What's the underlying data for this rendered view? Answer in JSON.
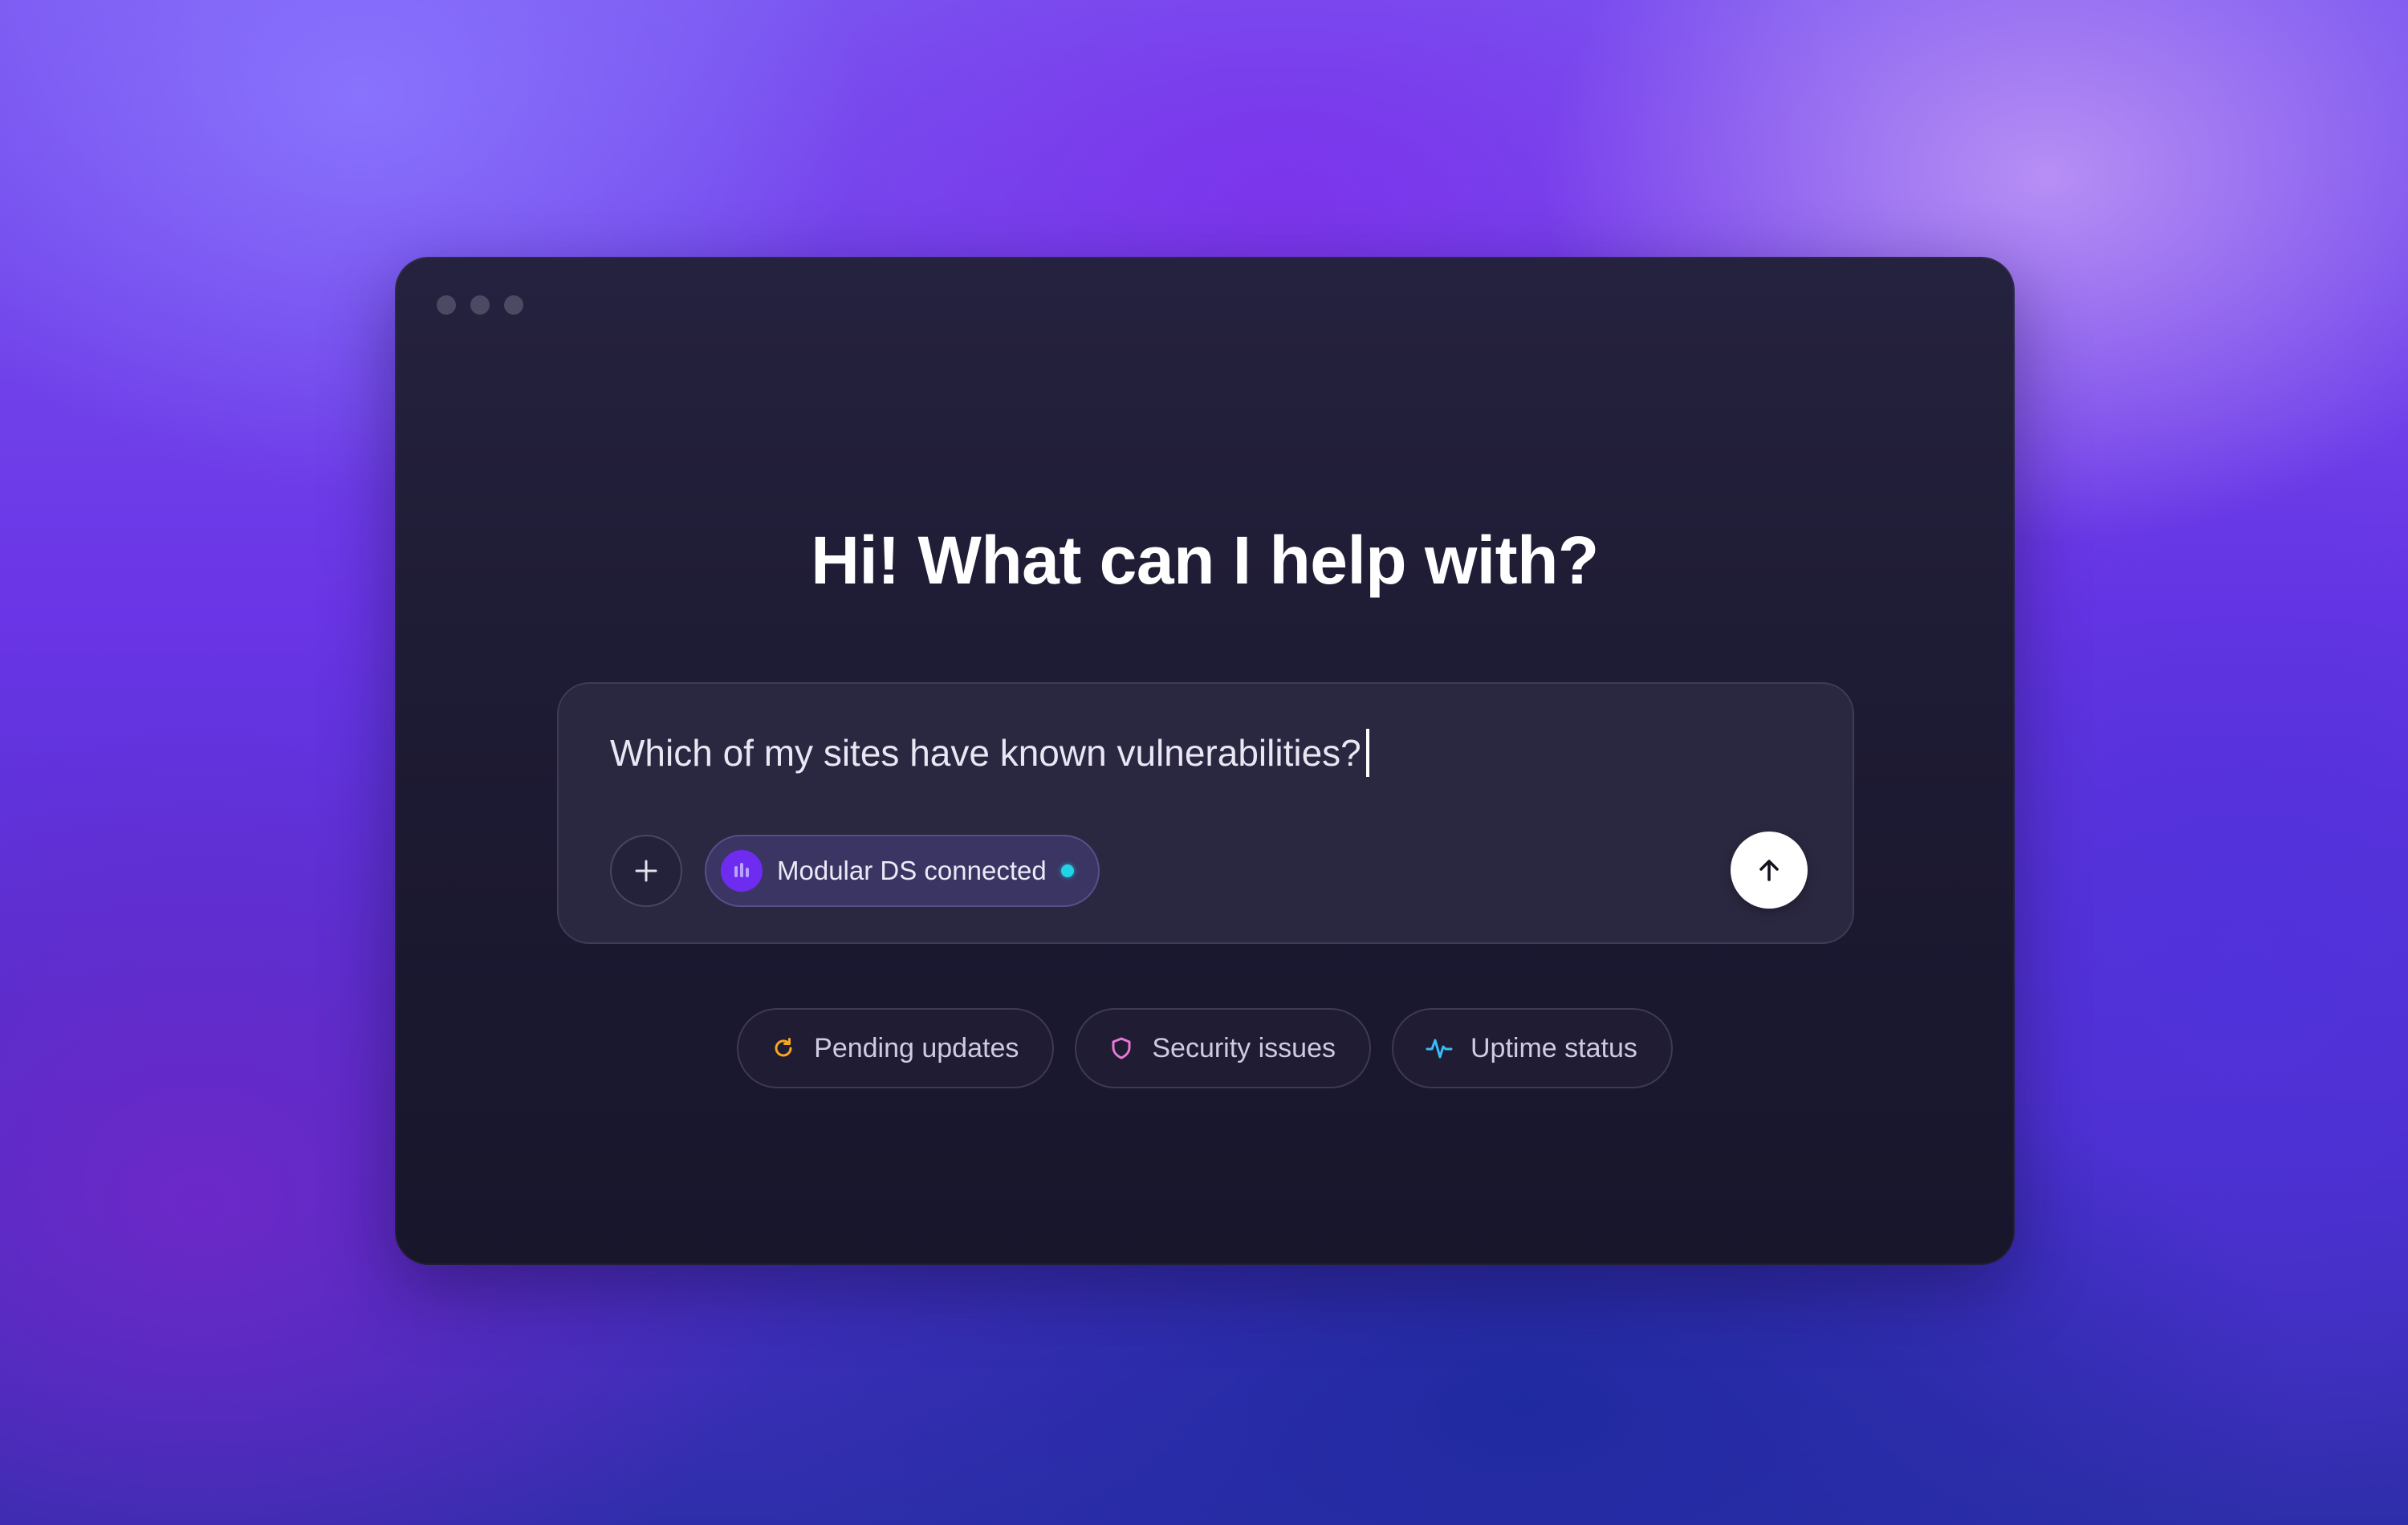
{
  "window": {
    "title_controls": [
      "dot",
      "dot",
      "dot"
    ]
  },
  "headline": "Hi! What can I help with?",
  "composer": {
    "input_value": "Which of my sites have known vulnerabilities?",
    "add_icon": "plus-icon",
    "connection": {
      "label": "Modular DS connected",
      "status": "connected",
      "status_color": "#22d3e6",
      "logo_icon": "modular-ds-logo-icon",
      "logo_color": "#6d2cf0"
    },
    "send_icon": "arrow-up-icon"
  },
  "suggestions": [
    {
      "label": "Pending updates",
      "icon": "refresh-icon",
      "icon_color": "#f5a623"
    },
    {
      "label": "Security issues",
      "icon": "shield-icon",
      "icon_color": "#e879d6"
    },
    {
      "label": "Uptime status",
      "icon": "activity-icon",
      "icon_color": "#38bdf8"
    }
  ]
}
